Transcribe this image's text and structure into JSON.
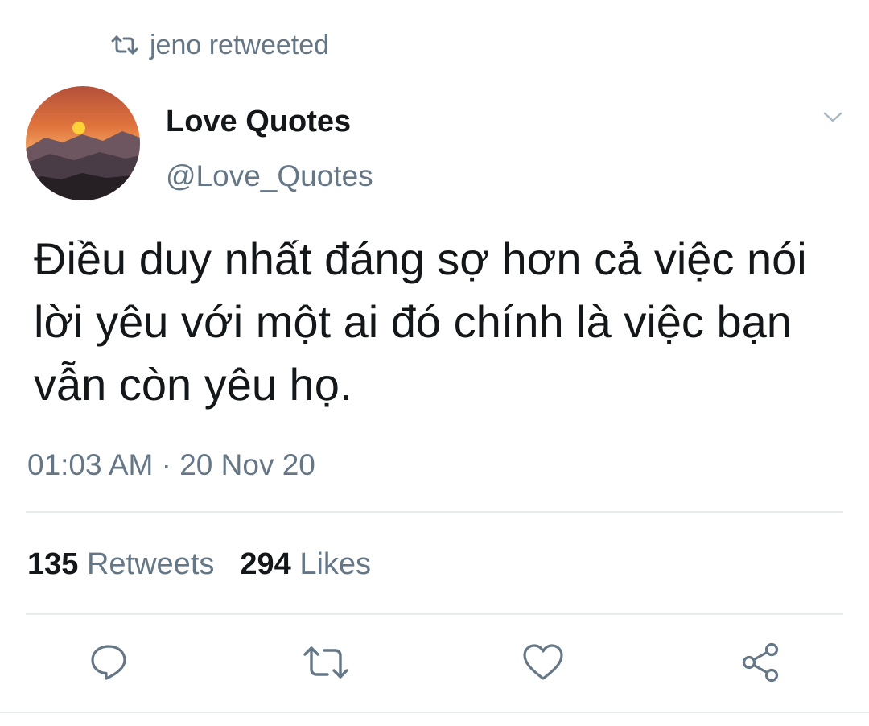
{
  "retweet_context": {
    "icon": "retweet-icon",
    "text": "jeno retweeted"
  },
  "author": {
    "display_name": "Love Quotes",
    "handle": "@Love_Quotes",
    "avatar": "sunset-mountain-avatar"
  },
  "tweet": {
    "text": "Điều duy nhất đáng sợ hơn cả việc nói lời yêu với một ai đó chính là việc bạn vẫn còn yêu họ.",
    "timestamp": "01:03 AM · 20 Nov 20"
  },
  "stats": {
    "retweets_count": "135",
    "retweets_label": "Retweets",
    "likes_count": "294",
    "likes_label": "Likes"
  },
  "actions": {
    "reply_icon": "reply-icon",
    "retweet_icon": "retweet-icon",
    "like_icon": "heart-icon",
    "share_icon": "share-icon"
  },
  "menu": {
    "icon": "chevron-down-icon"
  },
  "colors": {
    "text_primary": "#14171a",
    "text_secondary": "#657786",
    "divider": "#e6ecf0",
    "icon": "#657786"
  }
}
